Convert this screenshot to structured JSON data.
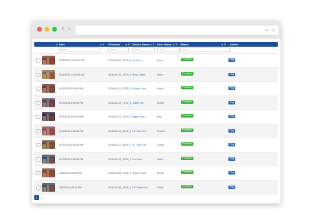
{
  "browser": {
    "back_icon": "‹",
    "forward_icon": "›",
    "search_icon": "⌕",
    "star_icon": "☆"
  },
  "table": {
    "columns": [
      {
        "label": "",
        "sort": "▲"
      },
      {
        "label": "Date",
        "sort": "▲▼"
      },
      {
        "label": "Filename",
        "sort": "▲▼"
      },
      {
        "label": "Device Name",
        "sort": "▲▼"
      },
      {
        "label": "User Name",
        "sort": "▲▼"
      },
      {
        "label": "Status",
        "sort": "▲▼"
      },
      {
        "label": "Action",
        "sort": ""
      }
    ],
    "filter_placeholder": "search",
    "rows": [
      {
        "date": "9/26/2016 12:00:00 PM",
        "filename": "2016-09-26_12:00_1",
        "device": "Device 4",
        "user": "Steve",
        "status": "Permitted",
        "action": "Play",
        "thumb_color": "#7a3b2e"
      },
      {
        "date": "9/26/2016 12:00:00 AM",
        "filename": "2016-09-26_12:00_1",
        "device": "Boss Tablet",
        "user": "Dave",
        "status": "Permitted",
        "action": "Play",
        "thumb_color": "#8a6a48"
      },
      {
        "date": "9/12/2016 5:30:00 PM",
        "filename": "2016-09-12_17:30_1",
        "device": "Shawn Cam",
        "user": "Mavis",
        "status": "Permitted",
        "action": "Play",
        "thumb_color": "#6b3a3a"
      },
      {
        "date": "9/12/2016 5:30:00 PM",
        "filename": "2016-09-12_17:30_1",
        "device": "Tablet 001",
        "user": "Daniel",
        "status": "Permitted",
        "action": "Play",
        "thumb_color": "#4a3e52"
      },
      {
        "date": "9/12/2016 5:00:00 PM",
        "filename": "2016-09-12_17:00_1",
        "device": "Night Cam 1",
        "user": "Roy",
        "status": "Permitted",
        "action": "Play",
        "thumb_color": "#2f2b3e"
      },
      {
        "date": "9/12/2016 4:30:00 PM",
        "filename": "2016-09-12_16:30_1",
        "device": "NY Cam 001",
        "user": "Frankie",
        "status": "Permitted",
        "action": "Play",
        "thumb_color": "#8a4a5a"
      },
      {
        "date": "9/12/2016 4:00:00 PM",
        "filename": "2016-09-12_16:00_1",
        "device": "VT Cam 013",
        "user": "Susan",
        "status": "Permitted",
        "action": "Play",
        "thumb_color": "#6d5038"
      },
      {
        "date": "9/12/2016 3:30:00 PM",
        "filename": "2016-09-12_15:30_1",
        "device": "Car Cam",
        "user": "Helen",
        "status": "Permitted",
        "action": "Play",
        "thumb_color": "#3f4a5e"
      },
      {
        "date": "9/8/2016 5:30:00 PM",
        "filename": "2016-09-08_17:30_1",
        "device": "Team 4 Cam",
        "user": "Emma",
        "status": "Permitted",
        "action": "Play",
        "thumb_color": "#7e4432"
      },
      {
        "date": "9/8/2016 4:30:00 PM",
        "filename": "2016-09-08_16:30_1",
        "device": "NY Tablet 016",
        "user": "Cathy",
        "status": "Permitted",
        "action": "Play",
        "thumb_color": "#4a4a55"
      }
    ]
  },
  "pagination": {
    "pages": [
      "1",
      "2"
    ],
    "current": "1"
  }
}
